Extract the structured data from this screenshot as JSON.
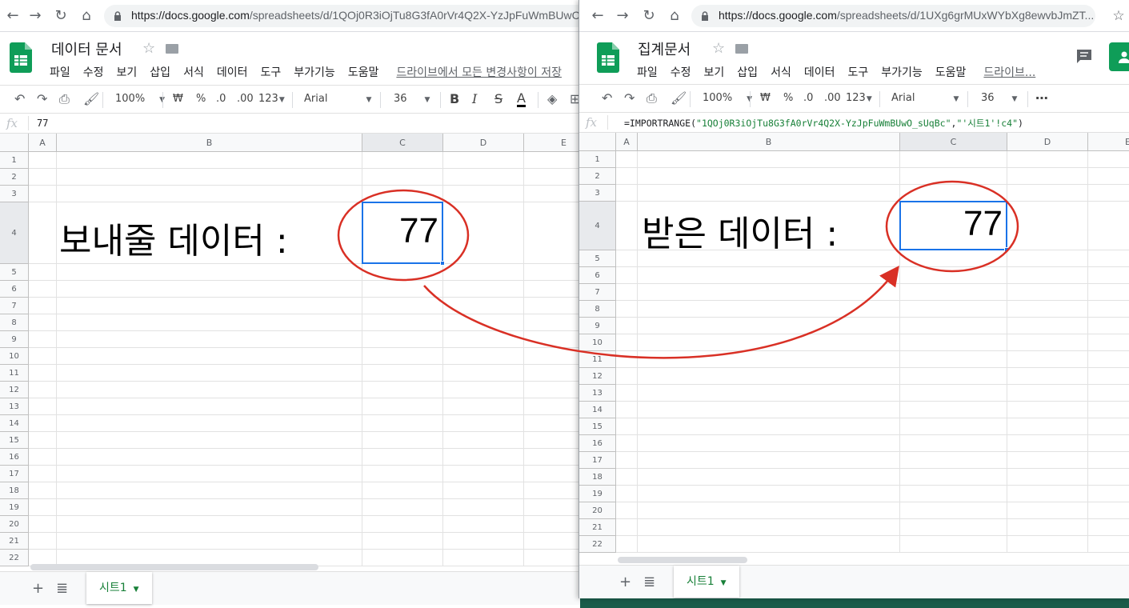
{
  "left": {
    "url_base": "https://docs.google.com",
    "url_path": "/spreadsheets/d/1QOj0R3iOjTu8G3fA0rVr4Q2X-YzJpFuWmBUwC",
    "doc_title": "데이터 문서",
    "menu": [
      "파일",
      "수정",
      "보기",
      "삽입",
      "서식",
      "데이터",
      "도구",
      "부가기능",
      "도움말"
    ],
    "drive_status": "드라이브에서 모든 변경사항이 저장",
    "toolbar": {
      "zoom": "100%",
      "currency": "₩",
      "percent": "%",
      "dec_less": ".0",
      "dec_more": ".00",
      "format_num": "123",
      "font": "Arial",
      "size": "36"
    },
    "formula": "77",
    "columns": [
      "A",
      "B",
      "C",
      "D",
      "E"
    ],
    "rows": [
      "1",
      "2",
      "3",
      "4",
      "5",
      "6",
      "7",
      "8",
      "9",
      "10",
      "11",
      "12",
      "13",
      "14",
      "15",
      "16",
      "17",
      "18",
      "19",
      "20",
      "21",
      "22"
    ],
    "label_text": "보내줄 데이터 :",
    "cell_value": "77",
    "sheet_tab": "시트1"
  },
  "right": {
    "url_base": "https://docs.google.com",
    "url_path": "/spreadsheets/d/1UXg6grMUxWYbXg8ewvbJmZT...",
    "doc_title": "집계문서",
    "menu": [
      "파일",
      "수정",
      "보기",
      "삽입",
      "서식",
      "데이터",
      "도구",
      "부가기능",
      "도움말"
    ],
    "drive_status": "드라이브...",
    "toolbar": {
      "zoom": "100%",
      "currency": "₩",
      "percent": "%",
      "dec_less": ".0",
      "dec_more": ".00",
      "format_num": "123",
      "font": "Arial",
      "size": "36",
      "more": "⋯"
    },
    "formula_fn": "=IMPORTRANGE(",
    "formula_arg1": "\"1QOj0R3iOjTu8G3fA0rVr4Q2X-YzJpFuWmBUwO_sUqBc\"",
    "formula_comma": ",",
    "formula_arg2": "\"'시트1'!c4\"",
    "formula_close": ")",
    "columns": [
      "A",
      "B",
      "C",
      "D",
      "E"
    ],
    "rows": [
      "1",
      "2",
      "3",
      "4",
      "5",
      "6",
      "7",
      "8",
      "9",
      "10",
      "11",
      "12",
      "13",
      "14",
      "15",
      "16",
      "17",
      "18",
      "19",
      "20",
      "21",
      "22"
    ],
    "label_text": "받은 데이터 :",
    "cell_value": "77",
    "sheet_tab": "시트1"
  },
  "colors": {
    "sheets_green": "#0f9d58",
    "selection_blue": "#1a73e8",
    "annotation_red": "#d93025",
    "tab_green": "#188038"
  },
  "icons": [
    "back-arrow-icon",
    "forward-arrow-icon",
    "reload-icon",
    "home-icon",
    "lock-icon",
    "star-icon",
    "folder-icon",
    "undo-icon",
    "redo-icon",
    "print-icon",
    "paint-format-icon",
    "bold-icon",
    "italic-icon",
    "strikethrough-icon",
    "text-color-icon",
    "fill-color-icon",
    "comment-icon",
    "share-icon",
    "add-sheet-icon",
    "all-sheets-icon"
  ]
}
